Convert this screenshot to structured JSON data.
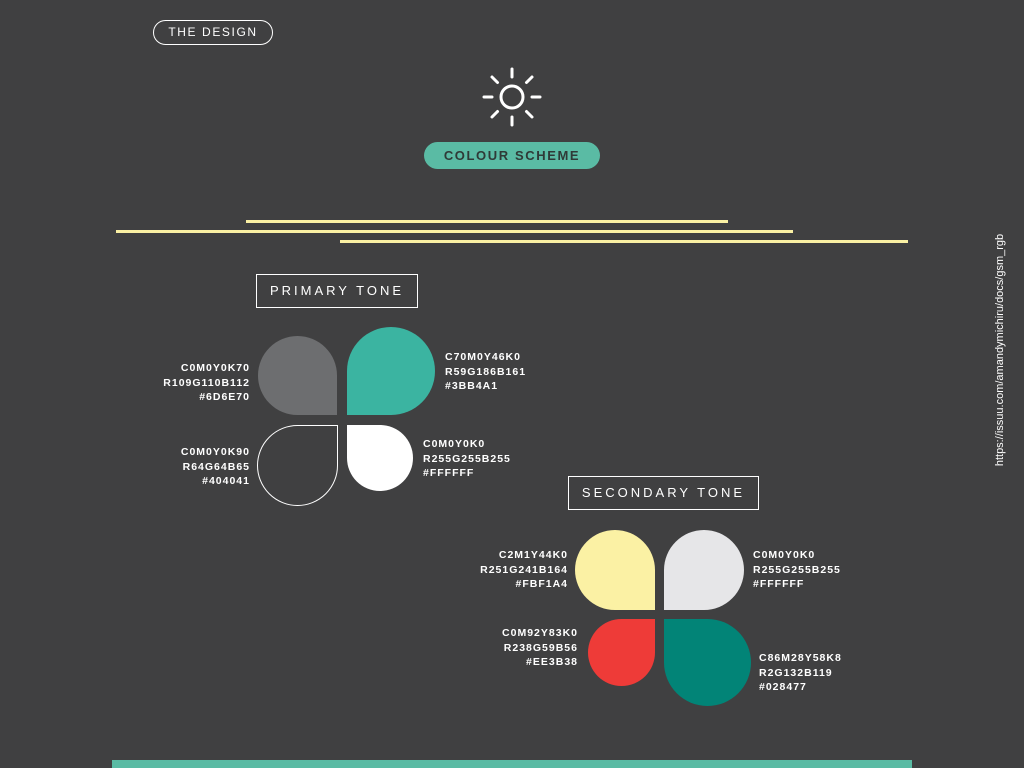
{
  "header": {
    "design_label": "THE DESIGN",
    "icon": "sun-icon"
  },
  "scheme": {
    "label": "COLOUR SCHEME",
    "color": "#5ABBA4"
  },
  "lines_color": "#FBF1A4",
  "primary": {
    "title": "PRIMARY TONE",
    "swatches": [
      {
        "name": "gray",
        "color": "#6D6E70",
        "cmyk": "C0M0Y0K70",
        "rgb": "R109G110B112",
        "hex": "#6D6E70"
      },
      {
        "name": "teal",
        "color": "#3BB4A1",
        "cmyk": "C70M0Y46K0",
        "rgb": "R59G186B161",
        "hex": "#3BB4A1"
      },
      {
        "name": "charcoal",
        "color": "#404041",
        "cmyk": "C0M0Y0K90",
        "rgb": "R64G64B65",
        "hex": "#404041"
      },
      {
        "name": "white",
        "color": "#FFFFFF",
        "cmyk": "C0M0Y0K0",
        "rgb": "R255G255B255",
        "hex": "#FFFFFF"
      }
    ]
  },
  "secondary": {
    "title": "SECONDARY TONE",
    "swatches": [
      {
        "name": "cream",
        "color": "#FBF1A4",
        "cmyk": "C2M1Y44K0",
        "rgb": "R251G241B164",
        "hex": "#FBF1A4"
      },
      {
        "name": "light-gray",
        "color": "#E6E6E8",
        "cmyk": "C0M0Y0K0",
        "rgb": "R255G255B255",
        "hex": "#FFFFFF"
      },
      {
        "name": "red",
        "color": "#EE3B38",
        "cmyk": "C0M92Y83K0",
        "rgb": "R238G59B56",
        "hex": "#EE3B38"
      },
      {
        "name": "dark-teal",
        "color": "#028477",
        "cmyk": "C86M28Y58K8",
        "rgb": "R2G132B119",
        "hex": "#028477"
      }
    ]
  },
  "side_url": "https://issuu.com/amandymichiru/docs/gsm_rgb",
  "bottom_bar_color": "#5ABBA4"
}
